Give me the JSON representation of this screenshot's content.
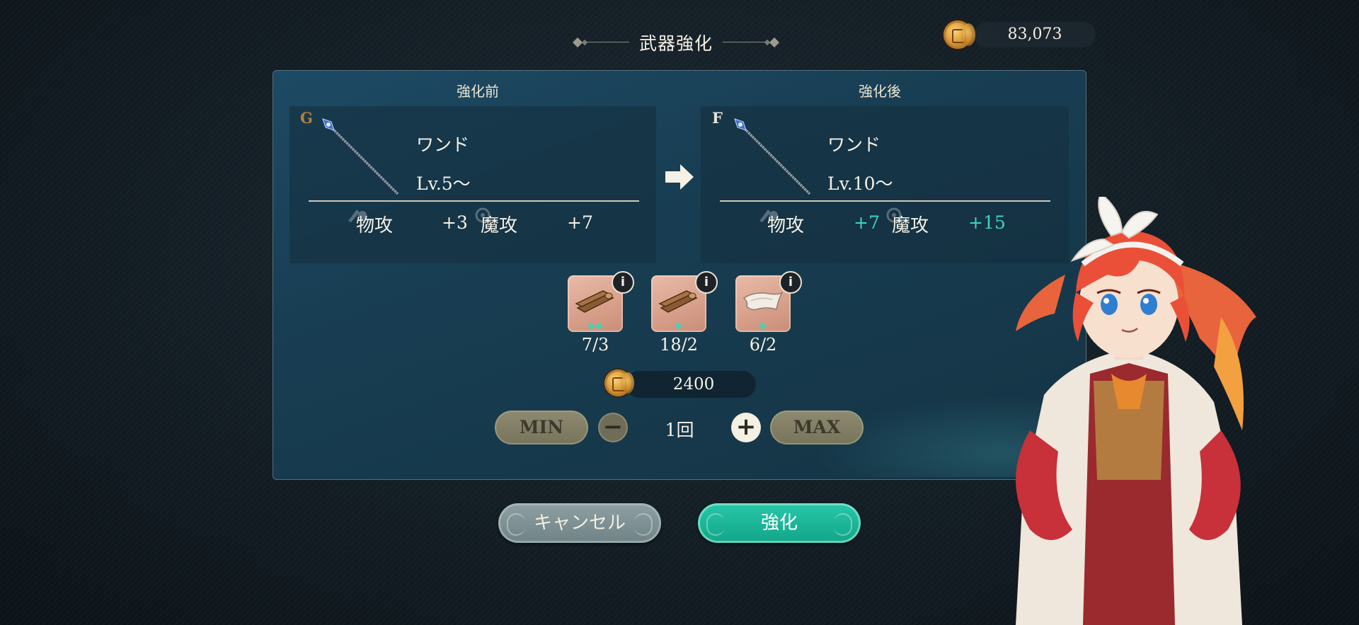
{
  "header": {
    "title": "武器強化",
    "currency": {
      "icon": "gold-coin-icon",
      "amount": "83,073"
    }
  },
  "before": {
    "heading": "強化前",
    "rank": "G",
    "weapon_icon": "wand-icon",
    "name": "ワンド",
    "level": "Lv.5〜",
    "stats": [
      {
        "label": "物攻",
        "value": "+3"
      },
      {
        "label": "魔攻",
        "value": "+7"
      }
    ]
  },
  "after": {
    "heading": "強化後",
    "rank": "F",
    "weapon_icon": "wand-icon",
    "name": "ワンド",
    "level": "Lv.10〜",
    "stats": [
      {
        "label": "物攻",
        "value": "+7"
      },
      {
        "label": "魔攻",
        "value": "+15"
      }
    ]
  },
  "materials": [
    {
      "icon": "lumber-icon",
      "count": "7/3",
      "rarity": 2
    },
    {
      "icon": "lumber-icon",
      "count": "18/2",
      "rarity": 1
    },
    {
      "icon": "cloth-icon",
      "count": "6/2",
      "rarity": 1
    }
  ],
  "cost": {
    "icon": "gold-coin-icon",
    "amount": "2400"
  },
  "quantity": {
    "min_label": "MIN",
    "max_label": "MAX",
    "minus": "−",
    "plus": "+",
    "value": "1回"
  },
  "buttons": {
    "cancel": "キャンセル",
    "confirm": "強化"
  },
  "info_glyph": "i",
  "colors": {
    "accent_teal": "#12a589",
    "stat_up": "#3fd6bd",
    "rank_g": "#b8803a",
    "rank_f": "#e8e4dc"
  }
}
